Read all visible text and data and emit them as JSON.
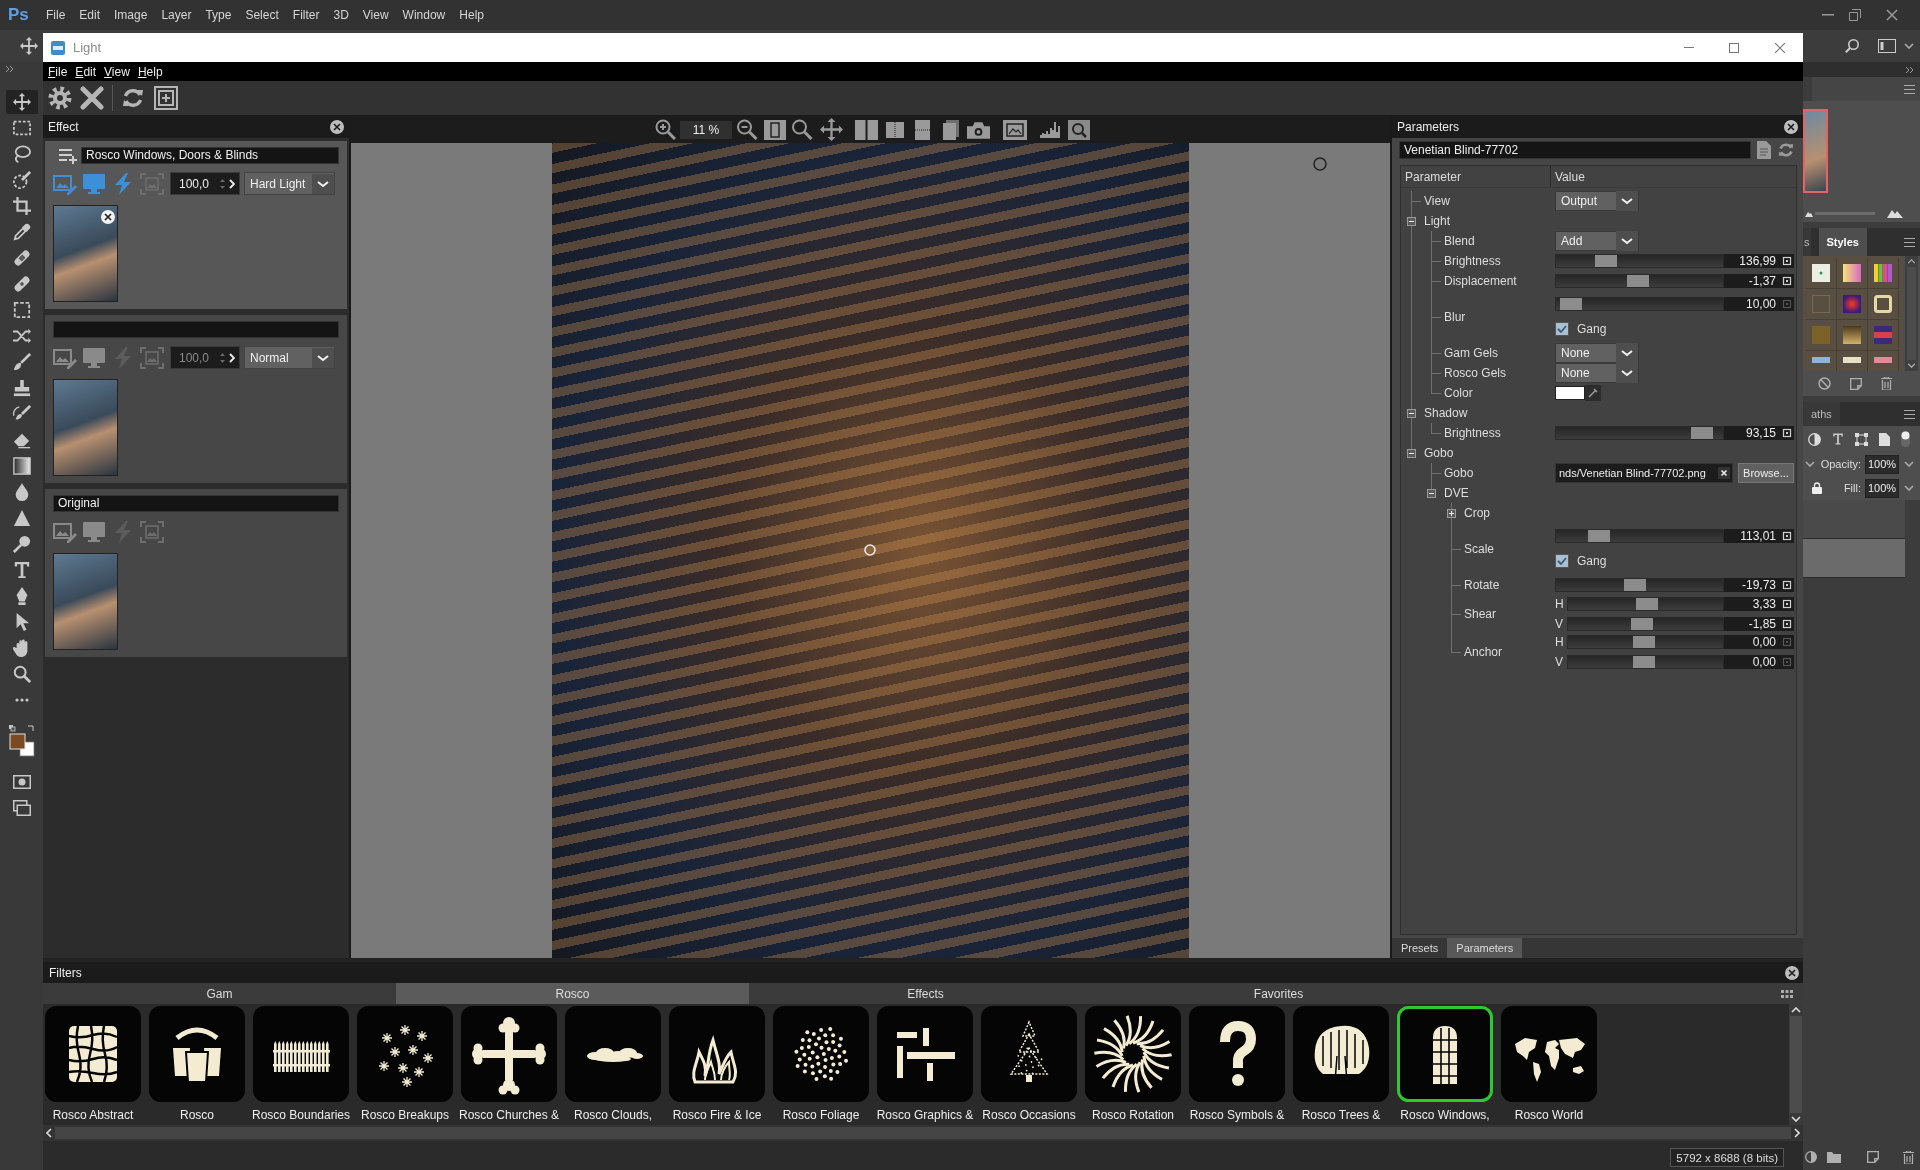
{
  "photoshop": {
    "logo": "Ps",
    "menu": [
      "File",
      "Edit",
      "Image",
      "Layer",
      "Type",
      "Select",
      "Filter",
      "3D",
      "View",
      "Window",
      "Help"
    ],
    "tools": [
      {
        "selected": true
      },
      {
        "selected": false
      },
      {
        "selected": false
      },
      {
        "selected": false
      },
      {
        "selected": false
      },
      {
        "selected": false
      },
      {
        "selected": false
      },
      {
        "selected": false
      },
      {
        "selected": false
      },
      {
        "selected": false
      },
      {
        "selected": false
      },
      {
        "selected": false
      },
      {
        "selected": false
      },
      {
        "selected": false
      },
      {
        "selected": false
      },
      {
        "selected": false
      },
      {
        "selected": false
      },
      {
        "selected": false
      },
      {
        "selected": false
      },
      {
        "selected": false
      },
      {
        "selected": false
      },
      {
        "selected": false
      },
      {
        "selected": false
      }
    ],
    "panels": {
      "tabs": [
        {
          "label": "s",
          "selected": false
        },
        {
          "label": "Styles",
          "selected": true
        }
      ],
      "paths_tab": "aths",
      "opacity_label": "Opacity:",
      "opacity": "100%",
      "fill_label": "Fill:",
      "fill": "100%",
      "layers": [
        {
          "selected": false
        },
        {
          "selected": true
        }
      ]
    }
  },
  "window": {
    "title": "Light",
    "menu": [
      "File",
      "Edit",
      "View",
      "Help"
    ]
  },
  "effect_panel": {
    "title": "Effect",
    "layers": [
      {
        "name": "Rosco Windows, Doors & Blinds",
        "selected": true,
        "closable": true,
        "opacity": "100,0",
        "blend": "Hard Light"
      },
      {
        "selected": false,
        "closable": false,
        "opacity": "100,0",
        "blend": "Normal"
      },
      {
        "name": "Original",
        "selected": false,
        "closable": false
      }
    ]
  },
  "viewer": {
    "zoom": "11 %"
  },
  "parameters": {
    "title": "Parameters",
    "preset": "Venetian Blind-77702",
    "columns": [
      "Parameter",
      "Value"
    ],
    "tree": [
      {
        "label": "View",
        "controls": [
          {
            "kind": "dropdown",
            "value": "Output"
          }
        ]
      },
      {
        "label": "Light",
        "expanded": true,
        "children": [
          {
            "label": "Blend",
            "controls": [
              {
                "kind": "dropdown",
                "value": "Add"
              }
            ]
          },
          {
            "label": "Brightness",
            "controls": [
              {
                "kind": "slider",
                "level": 0.27,
                "reading": "136,99",
                "modified": true
              }
            ]
          },
          {
            "label": "Displacement",
            "controls": [
              {
                "kind": "slider",
                "level": 0.49,
                "reading": "-1,37",
                "modified": true
              }
            ]
          },
          {
            "label": "Blur",
            "controls": [
              {
                "kind": "slider",
                "level": 0.03,
                "reading": "10,00",
                "modified": false
              },
              {
                "kind": "checkbox",
                "label": "Gang",
                "checked": true
              }
            ]
          },
          {
            "label": "Gam Gels",
            "controls": [
              {
                "kind": "dropdown",
                "value": "None"
              }
            ]
          },
          {
            "label": "Rosco Gels",
            "controls": [
              {
                "kind": "dropdown",
                "value": "None"
              }
            ]
          },
          {
            "label": "Color",
            "controls": [
              {
                "kind": "color",
                "color": "#ffffff"
              }
            ]
          }
        ]
      },
      {
        "label": "Shadow",
        "expanded": true,
        "children": [
          {
            "label": "Brightness",
            "controls": [
              {
                "kind": "slider",
                "level": 0.93,
                "reading": "93,15",
                "modified": true
              }
            ]
          }
        ]
      },
      {
        "label": "Gobo",
        "expanded": true,
        "children": [
          {
            "label": "Gobo",
            "controls": [
              {
                "kind": "file",
                "value": "nds/Venetian Blind-77702.png",
                "button": "Browse..."
              }
            ]
          },
          {
            "label": "DVE",
            "expanded": true,
            "children": [
              {
                "label": "Crop",
                "expanded": false
              },
              {
                "label": "Scale",
                "controls": [
                  {
                    "kind": "slider",
                    "level": 0.22,
                    "reading": "113,01",
                    "modified": true
                  },
                  {
                    "kind": "checkbox",
                    "label": "Gang",
                    "checked": true
                  }
                ]
              },
              {
                "label": "Rotate",
                "controls": [
                  {
                    "kind": "slider",
                    "level": 0.47,
                    "reading": "-19,73",
                    "modified": true
                  }
                ]
              },
              {
                "label": "Shear",
                "controls": [
                  {
                    "kind": "slider",
                    "axis": "H",
                    "level": 0.51,
                    "reading": "3,33",
                    "modified": true
                  },
                  {
                    "kind": "slider",
                    "axis": "V",
                    "level": 0.47,
                    "reading": "-1,85",
                    "modified": true
                  }
                ]
              },
              {
                "label": "Anchor",
                "controls": [
                  {
                    "kind": "slider",
                    "axis": "H",
                    "level": 0.49,
                    "reading": "0,00",
                    "modified": false
                  },
                  {
                    "kind": "slider",
                    "axis": "V",
                    "level": 0.49,
                    "reading": "0,00",
                    "modified": false
                  }
                ]
              }
            ]
          }
        ]
      }
    ],
    "tabs": [
      {
        "label": "Presets",
        "selected": false
      },
      {
        "label": "Parameters",
        "selected": true
      }
    ]
  },
  "filters": {
    "title": "Filters",
    "tabs": [
      {
        "label": "Gam",
        "selected": false
      },
      {
        "label": "Rosco",
        "selected": true
      },
      {
        "label": "Effects",
        "selected": false
      },
      {
        "label": "Favorites",
        "selected": false
      }
    ],
    "items": [
      {
        "label": "Rosco Abstract",
        "selected": false
      },
      {
        "label": "Rosco",
        "selected": false
      },
      {
        "label": "Rosco Boundaries",
        "selected": false
      },
      {
        "label": "Rosco Breakups",
        "selected": false
      },
      {
        "label": "Rosco Churches &",
        "selected": false
      },
      {
        "label": "Rosco Clouds,",
        "selected": false
      },
      {
        "label": "Rosco Fire & Ice",
        "selected": false
      },
      {
        "label": "Rosco Foliage",
        "selected": false
      },
      {
        "label": "Rosco Graphics &",
        "selected": false
      },
      {
        "label": "Rosco Occasions",
        "selected": false
      },
      {
        "label": "Rosco Rotation",
        "selected": false
      },
      {
        "label": "Rosco Symbols &",
        "selected": false
      },
      {
        "label": "Rosco Trees &",
        "selected": false
      },
      {
        "label": "Rosco Windows,",
        "selected": true
      },
      {
        "label": "Rosco World",
        "selected": false
      }
    ]
  },
  "status_bar": {
    "image_info": "5792 x 8688 (8 bits)"
  }
}
